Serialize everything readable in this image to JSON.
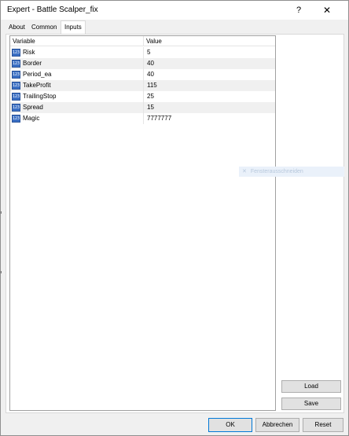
{
  "window": {
    "title": "Expert - Battle Scalper_fix",
    "help_glyph": "?",
    "close_glyph": "✕"
  },
  "tabs": [
    {
      "label": "About",
      "active": false
    },
    {
      "label": "Common",
      "active": false
    },
    {
      "label": "Inputs",
      "active": true
    }
  ],
  "inputs_table": {
    "columns": [
      "Variable",
      "Value"
    ],
    "rows": [
      {
        "variable": "Risk",
        "value": "5",
        "icon": "variable-type-icon"
      },
      {
        "variable": "Border",
        "value": "40",
        "icon": "variable-type-icon"
      },
      {
        "variable": "Period_ea",
        "value": "40",
        "icon": "variable-type-icon"
      },
      {
        "variable": "TakeProfit",
        "value": "115",
        "icon": "variable-type-icon"
      },
      {
        "variable": "TrailingStop",
        "value": "25",
        "icon": "variable-type-icon"
      },
      {
        "variable": "Spread",
        "value": "15",
        "icon": "variable-type-icon"
      },
      {
        "variable": "Magic",
        "value": "7777777",
        "icon": "variable-type-icon"
      }
    ],
    "icon_text": "123"
  },
  "ghost_tooltip": {
    "icon": "close-icon",
    "glyph": "✕",
    "text": "Fensterausschneiden"
  },
  "side_buttons": {
    "load": "Load",
    "save": "Save"
  },
  "footer_buttons": {
    "ok": "OK",
    "cancel": "Abbrechen",
    "reset": "Reset"
  },
  "colors": {
    "accent": "#0078d7",
    "icon_blue": "#3a6fc4",
    "row_alt": "#f0f0f0"
  }
}
